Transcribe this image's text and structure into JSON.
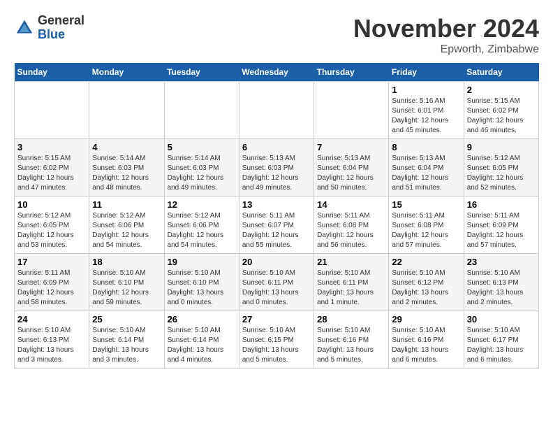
{
  "header": {
    "logo_general": "General",
    "logo_blue": "Blue",
    "month_title": "November 2024",
    "location": "Epworth, Zimbabwe"
  },
  "weekdays": [
    "Sunday",
    "Monday",
    "Tuesday",
    "Wednesday",
    "Thursday",
    "Friday",
    "Saturday"
  ],
  "weeks": [
    [
      {
        "day": "",
        "info": ""
      },
      {
        "day": "",
        "info": ""
      },
      {
        "day": "",
        "info": ""
      },
      {
        "day": "",
        "info": ""
      },
      {
        "day": "",
        "info": ""
      },
      {
        "day": "1",
        "info": "Sunrise: 5:16 AM\nSunset: 6:01 PM\nDaylight: 12 hours\nand 45 minutes."
      },
      {
        "day": "2",
        "info": "Sunrise: 5:15 AM\nSunset: 6:02 PM\nDaylight: 12 hours\nand 46 minutes."
      }
    ],
    [
      {
        "day": "3",
        "info": "Sunrise: 5:15 AM\nSunset: 6:02 PM\nDaylight: 12 hours\nand 47 minutes."
      },
      {
        "day": "4",
        "info": "Sunrise: 5:14 AM\nSunset: 6:03 PM\nDaylight: 12 hours\nand 48 minutes."
      },
      {
        "day": "5",
        "info": "Sunrise: 5:14 AM\nSunset: 6:03 PM\nDaylight: 12 hours\nand 49 minutes."
      },
      {
        "day": "6",
        "info": "Sunrise: 5:13 AM\nSunset: 6:03 PM\nDaylight: 12 hours\nand 49 minutes."
      },
      {
        "day": "7",
        "info": "Sunrise: 5:13 AM\nSunset: 6:04 PM\nDaylight: 12 hours\nand 50 minutes."
      },
      {
        "day": "8",
        "info": "Sunrise: 5:13 AM\nSunset: 6:04 PM\nDaylight: 12 hours\nand 51 minutes."
      },
      {
        "day": "9",
        "info": "Sunrise: 5:12 AM\nSunset: 6:05 PM\nDaylight: 12 hours\nand 52 minutes."
      }
    ],
    [
      {
        "day": "10",
        "info": "Sunrise: 5:12 AM\nSunset: 6:05 PM\nDaylight: 12 hours\nand 53 minutes."
      },
      {
        "day": "11",
        "info": "Sunrise: 5:12 AM\nSunset: 6:06 PM\nDaylight: 12 hours\nand 54 minutes."
      },
      {
        "day": "12",
        "info": "Sunrise: 5:12 AM\nSunset: 6:06 PM\nDaylight: 12 hours\nand 54 minutes."
      },
      {
        "day": "13",
        "info": "Sunrise: 5:11 AM\nSunset: 6:07 PM\nDaylight: 12 hours\nand 55 minutes."
      },
      {
        "day": "14",
        "info": "Sunrise: 5:11 AM\nSunset: 6:08 PM\nDaylight: 12 hours\nand 56 minutes."
      },
      {
        "day": "15",
        "info": "Sunrise: 5:11 AM\nSunset: 6:08 PM\nDaylight: 12 hours\nand 57 minutes."
      },
      {
        "day": "16",
        "info": "Sunrise: 5:11 AM\nSunset: 6:09 PM\nDaylight: 12 hours\nand 57 minutes."
      }
    ],
    [
      {
        "day": "17",
        "info": "Sunrise: 5:11 AM\nSunset: 6:09 PM\nDaylight: 12 hours\nand 58 minutes."
      },
      {
        "day": "18",
        "info": "Sunrise: 5:10 AM\nSunset: 6:10 PM\nDaylight: 12 hours\nand 59 minutes."
      },
      {
        "day": "19",
        "info": "Sunrise: 5:10 AM\nSunset: 6:10 PM\nDaylight: 13 hours\nand 0 minutes."
      },
      {
        "day": "20",
        "info": "Sunrise: 5:10 AM\nSunset: 6:11 PM\nDaylight: 13 hours\nand 0 minutes."
      },
      {
        "day": "21",
        "info": "Sunrise: 5:10 AM\nSunset: 6:11 PM\nDaylight: 13 hours\nand 1 minute."
      },
      {
        "day": "22",
        "info": "Sunrise: 5:10 AM\nSunset: 6:12 PM\nDaylight: 13 hours\nand 2 minutes."
      },
      {
        "day": "23",
        "info": "Sunrise: 5:10 AM\nSunset: 6:13 PM\nDaylight: 13 hours\nand 2 minutes."
      }
    ],
    [
      {
        "day": "24",
        "info": "Sunrise: 5:10 AM\nSunset: 6:13 PM\nDaylight: 13 hours\nand 3 minutes."
      },
      {
        "day": "25",
        "info": "Sunrise: 5:10 AM\nSunset: 6:14 PM\nDaylight: 13 hours\nand 3 minutes."
      },
      {
        "day": "26",
        "info": "Sunrise: 5:10 AM\nSunset: 6:14 PM\nDaylight: 13 hours\nand 4 minutes."
      },
      {
        "day": "27",
        "info": "Sunrise: 5:10 AM\nSunset: 6:15 PM\nDaylight: 13 hours\nand 5 minutes."
      },
      {
        "day": "28",
        "info": "Sunrise: 5:10 AM\nSunset: 6:16 PM\nDaylight: 13 hours\nand 5 minutes."
      },
      {
        "day": "29",
        "info": "Sunrise: 5:10 AM\nSunset: 6:16 PM\nDaylight: 13 hours\nand 6 minutes."
      },
      {
        "day": "30",
        "info": "Sunrise: 5:10 AM\nSunset: 6:17 PM\nDaylight: 13 hours\nand 6 minutes."
      }
    ]
  ]
}
